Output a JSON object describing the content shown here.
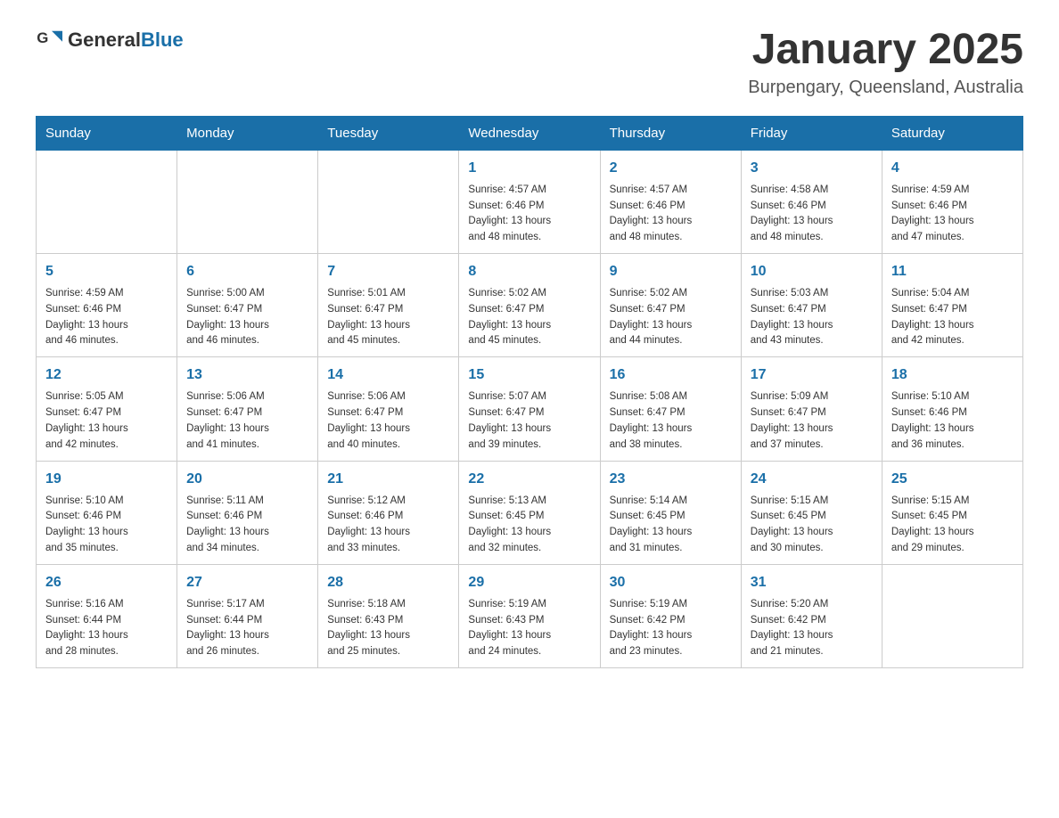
{
  "header": {
    "logo_general": "General",
    "logo_blue": "Blue",
    "title": "January 2025",
    "subtitle": "Burpengary, Queensland, Australia"
  },
  "days_of_week": [
    "Sunday",
    "Monday",
    "Tuesday",
    "Wednesday",
    "Thursday",
    "Friday",
    "Saturday"
  ],
  "weeks": [
    [
      null,
      null,
      null,
      {
        "day": 1,
        "sunrise": "4:57 AM",
        "sunset": "6:46 PM",
        "daylight_h": 13,
        "daylight_m": 48
      },
      {
        "day": 2,
        "sunrise": "4:57 AM",
        "sunset": "6:46 PM",
        "daylight_h": 13,
        "daylight_m": 48
      },
      {
        "day": 3,
        "sunrise": "4:58 AM",
        "sunset": "6:46 PM",
        "daylight_h": 13,
        "daylight_m": 48
      },
      {
        "day": 4,
        "sunrise": "4:59 AM",
        "sunset": "6:46 PM",
        "daylight_h": 13,
        "daylight_m": 47
      }
    ],
    [
      {
        "day": 5,
        "sunrise": "4:59 AM",
        "sunset": "6:46 PM",
        "daylight_h": 13,
        "daylight_m": 46
      },
      {
        "day": 6,
        "sunrise": "5:00 AM",
        "sunset": "6:47 PM",
        "daylight_h": 13,
        "daylight_m": 46
      },
      {
        "day": 7,
        "sunrise": "5:01 AM",
        "sunset": "6:47 PM",
        "daylight_h": 13,
        "daylight_m": 45
      },
      {
        "day": 8,
        "sunrise": "5:02 AM",
        "sunset": "6:47 PM",
        "daylight_h": 13,
        "daylight_m": 45
      },
      {
        "day": 9,
        "sunrise": "5:02 AM",
        "sunset": "6:47 PM",
        "daylight_h": 13,
        "daylight_m": 44
      },
      {
        "day": 10,
        "sunrise": "5:03 AM",
        "sunset": "6:47 PM",
        "daylight_h": 13,
        "daylight_m": 43
      },
      {
        "day": 11,
        "sunrise": "5:04 AM",
        "sunset": "6:47 PM",
        "daylight_h": 13,
        "daylight_m": 42
      }
    ],
    [
      {
        "day": 12,
        "sunrise": "5:05 AM",
        "sunset": "6:47 PM",
        "daylight_h": 13,
        "daylight_m": 42
      },
      {
        "day": 13,
        "sunrise": "5:06 AM",
        "sunset": "6:47 PM",
        "daylight_h": 13,
        "daylight_m": 41
      },
      {
        "day": 14,
        "sunrise": "5:06 AM",
        "sunset": "6:47 PM",
        "daylight_h": 13,
        "daylight_m": 40
      },
      {
        "day": 15,
        "sunrise": "5:07 AM",
        "sunset": "6:47 PM",
        "daylight_h": 13,
        "daylight_m": 39
      },
      {
        "day": 16,
        "sunrise": "5:08 AM",
        "sunset": "6:47 PM",
        "daylight_h": 13,
        "daylight_m": 38
      },
      {
        "day": 17,
        "sunrise": "5:09 AM",
        "sunset": "6:47 PM",
        "daylight_h": 13,
        "daylight_m": 37
      },
      {
        "day": 18,
        "sunrise": "5:10 AM",
        "sunset": "6:46 PM",
        "daylight_h": 13,
        "daylight_m": 36
      }
    ],
    [
      {
        "day": 19,
        "sunrise": "5:10 AM",
        "sunset": "6:46 PM",
        "daylight_h": 13,
        "daylight_m": 35
      },
      {
        "day": 20,
        "sunrise": "5:11 AM",
        "sunset": "6:46 PM",
        "daylight_h": 13,
        "daylight_m": 34
      },
      {
        "day": 21,
        "sunrise": "5:12 AM",
        "sunset": "6:46 PM",
        "daylight_h": 13,
        "daylight_m": 33
      },
      {
        "day": 22,
        "sunrise": "5:13 AM",
        "sunset": "6:45 PM",
        "daylight_h": 13,
        "daylight_m": 32
      },
      {
        "day": 23,
        "sunrise": "5:14 AM",
        "sunset": "6:45 PM",
        "daylight_h": 13,
        "daylight_m": 31
      },
      {
        "day": 24,
        "sunrise": "5:15 AM",
        "sunset": "6:45 PM",
        "daylight_h": 13,
        "daylight_m": 30
      },
      {
        "day": 25,
        "sunrise": "5:15 AM",
        "sunset": "6:45 PM",
        "daylight_h": 13,
        "daylight_m": 29
      }
    ],
    [
      {
        "day": 26,
        "sunrise": "5:16 AM",
        "sunset": "6:44 PM",
        "daylight_h": 13,
        "daylight_m": 28
      },
      {
        "day": 27,
        "sunrise": "5:17 AM",
        "sunset": "6:44 PM",
        "daylight_h": 13,
        "daylight_m": 26
      },
      {
        "day": 28,
        "sunrise": "5:18 AM",
        "sunset": "6:43 PM",
        "daylight_h": 13,
        "daylight_m": 25
      },
      {
        "day": 29,
        "sunrise": "5:19 AM",
        "sunset": "6:43 PM",
        "daylight_h": 13,
        "daylight_m": 24
      },
      {
        "day": 30,
        "sunrise": "5:19 AM",
        "sunset": "6:42 PM",
        "daylight_h": 13,
        "daylight_m": 23
      },
      {
        "day": 31,
        "sunrise": "5:20 AM",
        "sunset": "6:42 PM",
        "daylight_h": 13,
        "daylight_m": 21
      },
      null
    ]
  ]
}
